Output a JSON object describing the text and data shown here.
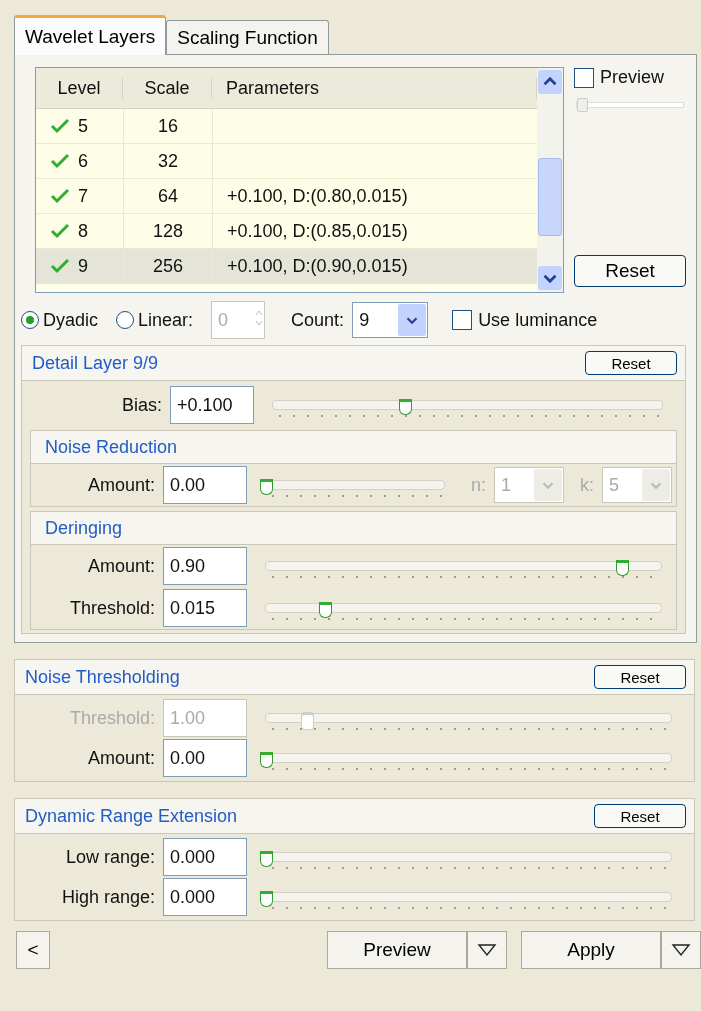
{
  "tabs": [
    {
      "label": "Wavelet Layers",
      "selected": true
    },
    {
      "label": "Scaling Function",
      "selected": false
    }
  ],
  "table": {
    "columns": [
      "Level",
      "Scale",
      "Parameters"
    ],
    "rows": [
      {
        "level": "5",
        "scale": "16",
        "parameters": "",
        "checked": true,
        "selected": false
      },
      {
        "level": "6",
        "scale": "32",
        "parameters": "",
        "checked": true,
        "selected": false
      },
      {
        "level": "7",
        "scale": "64",
        "parameters": "+0.100, D:(0.80,0.015)",
        "checked": true,
        "selected": false
      },
      {
        "level": "8",
        "scale": "128",
        "parameters": "+0.100, D:(0.85,0.015)",
        "checked": true,
        "selected": false
      },
      {
        "level": "9",
        "scale": "256",
        "parameters": "+0.100, D:(0.90,0.015)",
        "checked": true,
        "selected": true
      }
    ]
  },
  "preview": {
    "label": "Preview",
    "checked": false,
    "level": 0
  },
  "reset_button": "Reset",
  "modes": [
    {
      "label": "Dyadic",
      "selected": true
    },
    {
      "label": "Linear:",
      "selected": false
    }
  ],
  "linear_value": {
    "value": "0",
    "disabled": true
  },
  "count": {
    "label": "Count:",
    "value": "9"
  },
  "use_luminance": {
    "label": "Use luminance",
    "checked": false
  },
  "detail_panel": {
    "title": "Detail Layer 9/9",
    "reset": "Reset",
    "rows": [
      {
        "label": "Bias:",
        "value": "+0.100",
        "level": 0.34,
        "disabled": false
      }
    ],
    "subsections": [
      {
        "title": "Noise Reduction",
        "rows": [
          {
            "label": "Amount:",
            "value": "0.00",
            "level": 0,
            "disabled": false,
            "extras": [
              {
                "label": "n:",
                "value": "1",
                "disabled": true
              },
              {
                "label": "k:",
                "value": "5",
                "disabled": true
              }
            ]
          }
        ]
      },
      {
        "title": "Deringing",
        "rows": [
          {
            "label": "Amount:",
            "value": "0.90",
            "level": 0.9,
            "disabled": false
          },
          {
            "label": "Threshold:",
            "value": "0.015",
            "level": 0.15,
            "disabled": false
          }
        ]
      }
    ]
  },
  "panels": [
    {
      "title": "Noise Thresholding",
      "reset": "Reset",
      "rows": [
        {
          "label": "Threshold:",
          "value": "1.00",
          "level": 0.1,
          "disabled": true
        },
        {
          "label": "Amount:",
          "value": "0.00",
          "level": 0,
          "disabled": false
        }
      ]
    },
    {
      "title": "Dynamic Range Extension",
      "reset": "Reset",
      "rows": [
        {
          "label": "Low range:",
          "value": "0.000",
          "level": 0,
          "disabled": false
        },
        {
          "label": "High range:",
          "value": "0.000",
          "level": 0,
          "disabled": false
        }
      ]
    }
  ],
  "bottom": {
    "back": "<",
    "preview": "Preview",
    "apply": "Apply"
  }
}
